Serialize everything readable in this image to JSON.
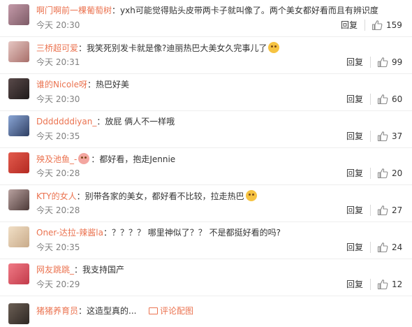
{
  "comments": [
    {
      "username": "啊门啊前一棵葡萄树",
      "text": "：yxh可能觉得贴头皮带两卡子就叫像了。两个美女都好看而且有辨识度",
      "time": "今天 20:30",
      "reply": "回复",
      "likes": "159"
    },
    {
      "username": "三桥超可爱",
      "text": "：我笑死别发卡就是像?迪丽热巴大美女久完事儿了",
      "emoji": "surprised-emoji",
      "time": "今天 20:31",
      "reply": "回复",
      "likes": "99"
    },
    {
      "username": "谁的Nicole呀",
      "text": "：热巴好美",
      "time": "今天 20:30",
      "reply": "回复",
      "likes": "60"
    },
    {
      "username": "Dddddddiyan_",
      "text": "：放屁 俩人不一样哦",
      "time": "今天 20:35",
      "reply": "回复",
      "likes": "37"
    },
    {
      "username": "殃及池鱼_-",
      "text": "：都好看，抱走Jennie",
      "emoji_before_text": "cute-emoji",
      "time": "今天 20:28",
      "reply": "回复",
      "likes": "20"
    },
    {
      "username": "KTY的女人",
      "text": "：别带各家的美女，都好看不比较，拉走热巴",
      "emoji": "shy-emoji",
      "time": "今天 20:28",
      "reply": "回复",
      "likes": "27"
    },
    {
      "username": "Oner-达拉-辣酱la",
      "text": "：？？？？ 哪里神似了？？ 不是都挺好看的吗?",
      "time": "今天 20:35",
      "reply": "回复",
      "likes": "24"
    },
    {
      "username": "网友跳跳_",
      "text": "：我支持国产",
      "time": "今天 20:29",
      "reply": "回复",
      "likes": "12"
    },
    {
      "username": "猪猪养育员",
      "text": "：这造型真的...",
      "trail": "评论配图",
      "time": "",
      "reply": "",
      "likes": ""
    }
  ],
  "colors": {
    "username": "#eb7350",
    "text": "#333333",
    "time": "#808080"
  }
}
